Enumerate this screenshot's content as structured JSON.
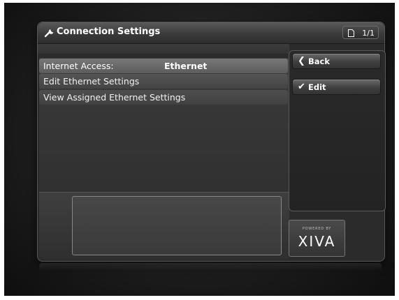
{
  "window": {
    "title": "Connection Settings",
    "title_icon": "wrench-icon",
    "page_indicator": "1/1",
    "page_icon": "document-icon"
  },
  "list": {
    "items": [
      {
        "label": "Internet Access:",
        "value": "Ethernet",
        "selected": true
      },
      {
        "label": "Edit Ethernet Settings"
      },
      {
        "label": "View Assigned Ethernet Settings"
      }
    ]
  },
  "side_panel": {
    "back_label": "Back",
    "back_icon": "chevron-left-icon",
    "edit_label": "Edit",
    "edit_icon": "checkmark-icon"
  },
  "logo": {
    "tagline": "POWERED BY",
    "name": "XIVA"
  },
  "colors": {
    "background": "#1c1c1c",
    "selected_row": "#6a6a6a",
    "text": "#ffffff"
  }
}
